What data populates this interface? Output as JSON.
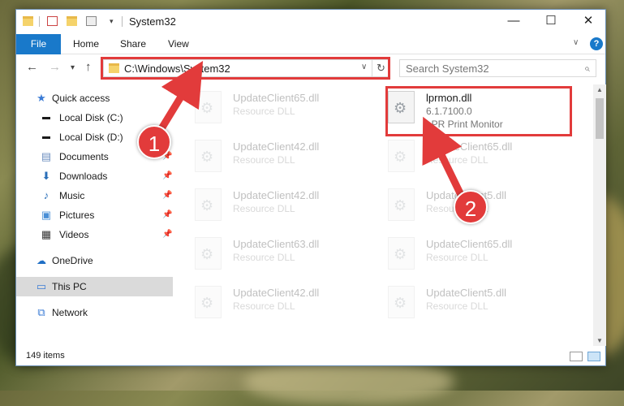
{
  "window": {
    "title": "System32",
    "controls": {
      "minimize": "—",
      "maximize": "☐",
      "close": "✕"
    }
  },
  "ribbon": {
    "tabs": [
      "File",
      "Home",
      "Share",
      "View"
    ],
    "help": "?"
  },
  "nav": {
    "back": "←",
    "forward": "→",
    "recent": "▾",
    "up": "↑",
    "address": "C:\\Windows\\System32",
    "search_placeholder": "Search System32"
  },
  "sidebar": {
    "items": [
      {
        "label": "Quick access",
        "icon": "star-icon"
      },
      {
        "label": "Local Disk (C:)",
        "icon": "drive-icon"
      },
      {
        "label": "Local Disk (D:)",
        "icon": "drive-icon"
      },
      {
        "label": "Documents",
        "icon": "documents-icon",
        "pinned": true
      },
      {
        "label": "Downloads",
        "icon": "downloads-icon",
        "pinned": true
      },
      {
        "label": "Music",
        "icon": "music-icon",
        "pinned": true
      },
      {
        "label": "Pictures",
        "icon": "pictures-icon",
        "pinned": true
      },
      {
        "label": "Videos",
        "icon": "videos-icon",
        "pinned": true
      },
      {
        "label": "OneDrive",
        "icon": "onedrive-icon"
      },
      {
        "label": "This PC",
        "icon": "pc-icon",
        "selected": true
      },
      {
        "label": "Network",
        "icon": "network-icon"
      }
    ]
  },
  "files": {
    "highlighted": {
      "name": "lprmon.dll",
      "version": "6.1.7100.0",
      "description": "LPR Print Monitor"
    },
    "left_column": [
      {
        "name": "UpdateClient65.dll",
        "type": "Resource DLL"
      },
      {
        "name": "UpdateClient42.dll",
        "type": "Resource DLL"
      },
      {
        "name": "UpdateClient42.dll",
        "type": "Resource DLL"
      },
      {
        "name": "UpdateClient63.dll",
        "type": "Resource DLL"
      },
      {
        "name": "UpdateClient42.dll",
        "type": "Resource DLL"
      }
    ],
    "right_column": [
      {
        "name": "UpdateClient65.dll",
        "type": "Resource DLL"
      },
      {
        "name": "UpdateClient5.dll",
        "type": "Resource DLL"
      },
      {
        "name": "UpdateClient65.dll",
        "type": "Resource DLL"
      },
      {
        "name": "UpdateClient5.dll",
        "type": "Resource DLL"
      }
    ]
  },
  "status": {
    "item_count": "149 items"
  },
  "annotations": {
    "step1": "1",
    "step2": "2",
    "color": "#e23b3b"
  }
}
